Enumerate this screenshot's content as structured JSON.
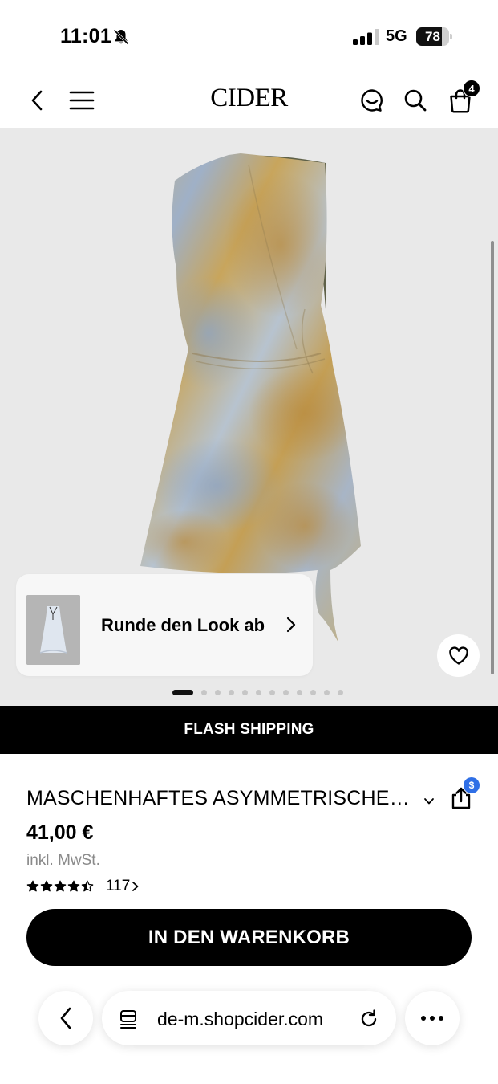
{
  "status_bar": {
    "time": "11:01",
    "network": "5G",
    "battery_percent": "78",
    "battery_level": 0.78,
    "icons": [
      "bell-muted-icon",
      "cellular-signal-icon",
      "battery-icon"
    ]
  },
  "header": {
    "logo": "CIDER",
    "cart_count": "4",
    "icons": [
      "back-icon",
      "menu-icon",
      "chat-icon",
      "search-icon",
      "cart-icon"
    ]
  },
  "gallery": {
    "complete_look_label": "Runde den Look ab",
    "image_count": 12,
    "active_index": 0,
    "icons": [
      "chevron-right-icon",
      "heart-icon"
    ]
  },
  "banner": {
    "flash_label": "FLASH SHIPPING"
  },
  "product": {
    "title": "MASCHENHAFTES ASYMMETRISCHES MINIKLEID",
    "price": "41,00 €",
    "tax_note": "inkl. MwSt.",
    "rating": 4.5,
    "review_count": "117",
    "share_badge": "$",
    "add_to_cart_label": "IN DEN WARENKORB",
    "icons": [
      "chevron-down-icon",
      "share-icon",
      "star-icon"
    ]
  },
  "browser": {
    "url": "de-m.shopcider.com",
    "icons": [
      "browser-back-icon",
      "tabs-icon",
      "reload-icon",
      "more-icon"
    ]
  },
  "colors": {
    "accent": "#000000",
    "gallery_background": "#e9e9e9",
    "badge_blue": "#2f6fe6",
    "muted_text": "#8a8a8a"
  }
}
